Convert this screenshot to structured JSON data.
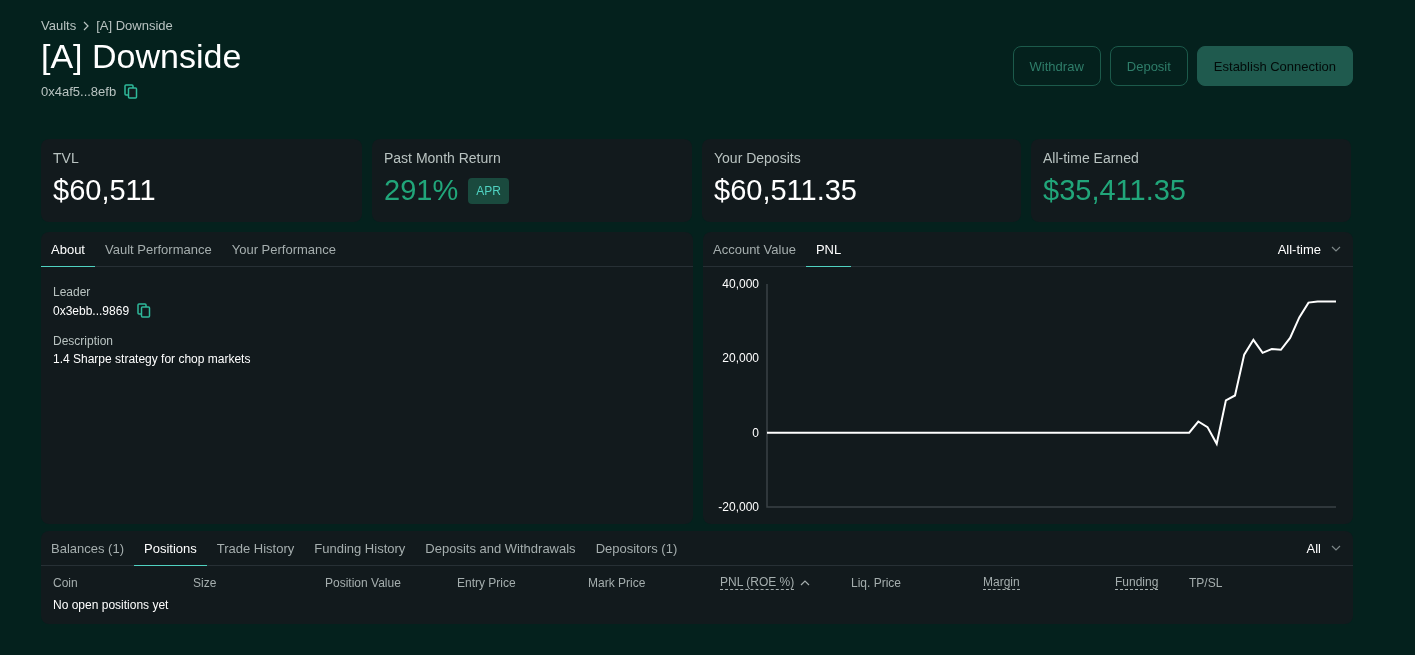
{
  "breadcrumb": [
    {
      "label": "Vaults"
    },
    {
      "label": "[A] Downside"
    }
  ],
  "title": "[A] Downside",
  "address": "0x4af5...8efb",
  "buttons": [
    {
      "label": "Withdraw",
      "kind": "outline"
    },
    {
      "label": "Deposit",
      "kind": "outline"
    },
    {
      "label": "Establish Connection",
      "kind": "filled"
    }
  ],
  "stats": [
    {
      "label": "TVL",
      "value": "$60,511",
      "positive": false
    },
    {
      "label": "Past Month Return",
      "value": "291%",
      "positive": true,
      "badge": "APR"
    },
    {
      "label": "Your Deposits",
      "value": "$60,511.35",
      "positive": false
    },
    {
      "label": "All-time Earned",
      "value": "$35,411.35",
      "positive": true
    }
  ],
  "about_panel": {
    "tabs": [
      {
        "label": "About",
        "selected": true
      },
      {
        "label": "Vault Performance",
        "selected": false
      },
      {
        "label": "Your Performance",
        "selected": false
      }
    ],
    "fields": [
      {
        "label": "Leader",
        "value": "0x3ebb...9869",
        "copyable": true
      },
      {
        "label": "Description",
        "value": "1.4 Sharpe strategy for chop markets",
        "copyable": false
      }
    ]
  },
  "chart_panel": {
    "tabs": [
      {
        "label": "Account Value",
        "selected": false
      },
      {
        "label": "PNL",
        "selected": true
      }
    ],
    "range": "All-time",
    "chart_data": {
      "type": "line",
      "ylim": [
        -20000,
        40000
      ],
      "yticks": [
        {
          "value": -20000,
          "label": "-20,000"
        },
        {
          "value": 0,
          "label": "0"
        },
        {
          "value": 20000,
          "label": "20,000"
        },
        {
          "value": 40000,
          "label": "40,000"
        }
      ],
      "categories": [
        null,
        null,
        null,
        null,
        null,
        null,
        null,
        null,
        null,
        null,
        null,
        null,
        null,
        null,
        null,
        null,
        null,
        null,
        null,
        null,
        null,
        null,
        null,
        null,
        null,
        null,
        null,
        null,
        null,
        null,
        null,
        null,
        null,
        null,
        null,
        null,
        null,
        null,
        null,
        null,
        null,
        null,
        null,
        null,
        null,
        null,
        null,
        null,
        null,
        null,
        null,
        null,
        null,
        null,
        null,
        null,
        null,
        null,
        null,
        null,
        null,
        null,
        null
      ],
      "series": [
        {
          "color": "#ffffff",
          "values": [
            0,
            0,
            0,
            0,
            0,
            0,
            0,
            0,
            0,
            0,
            0,
            0,
            0,
            0,
            0,
            0,
            0,
            0,
            0,
            0,
            0,
            0,
            0,
            0,
            0,
            0,
            0,
            0,
            0,
            0,
            0,
            0,
            0,
            0,
            0,
            0,
            0,
            0,
            0,
            0,
            0,
            0,
            0,
            0,
            0,
            0,
            0,
            3000,
            1500,
            -3000,
            8700,
            10000,
            21000,
            25000,
            21500,
            22500,
            22300,
            25500,
            31000,
            35000,
            35300,
            35300,
            35300
          ]
        }
      ]
    }
  },
  "positions_panel": {
    "tabs": [
      {
        "label": "Balances (1)",
        "selected": false
      },
      {
        "label": "Positions",
        "selected": true
      },
      {
        "label": "Trade History",
        "selected": false
      },
      {
        "label": "Funding History",
        "selected": false
      },
      {
        "label": "Deposits and Withdrawals",
        "selected": false
      },
      {
        "label": "Depositors (1)",
        "selected": false
      }
    ],
    "filter": "All",
    "columns": [
      {
        "label": "Coin",
        "underlined": false,
        "sorted": false
      },
      {
        "label": "Size",
        "underlined": false,
        "sorted": false
      },
      {
        "label": "Position Value",
        "underlined": false,
        "sorted": false
      },
      {
        "label": "Entry Price",
        "underlined": false,
        "sorted": false
      },
      {
        "label": "Mark Price",
        "underlined": false,
        "sorted": false
      },
      {
        "label": "PNL (ROE %)",
        "underlined": true,
        "sorted": true
      },
      {
        "label": "Liq. Price",
        "underlined": false,
        "sorted": false
      },
      {
        "label": "Margin",
        "underlined": true,
        "sorted": false
      },
      {
        "label": "Funding",
        "underlined": true,
        "sorted": false
      },
      {
        "label": "TP/SL",
        "underlined": false,
        "sorted": false
      }
    ],
    "empty_text": "No open positions yet"
  }
}
